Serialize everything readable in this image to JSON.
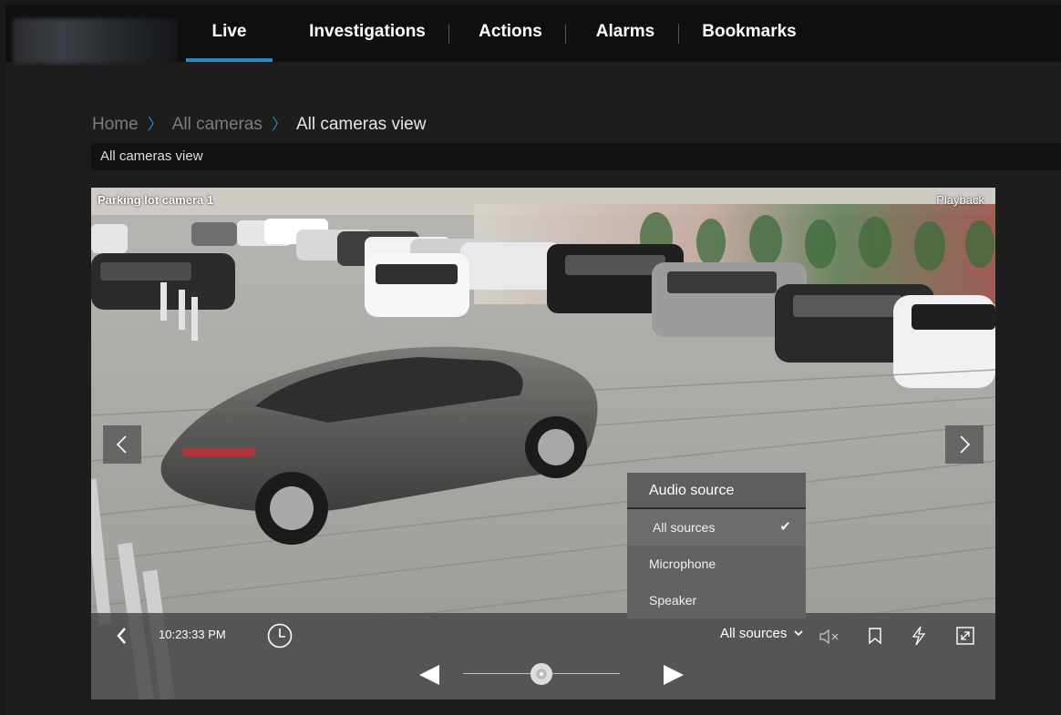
{
  "nav": {
    "tabs": [
      {
        "label": "Live",
        "active": true
      },
      {
        "label": "Investigations"
      },
      {
        "label": "Actions"
      },
      {
        "label": "Alarms"
      },
      {
        "label": "Bookmarks"
      }
    ]
  },
  "breadcrumb": {
    "items": [
      "Home",
      "All cameras",
      "All cameras view"
    ],
    "separator": "〉"
  },
  "view_name": "All cameras view",
  "camera": {
    "title": "Parking lot camera 1",
    "playback_label": "Playback",
    "prev_icon": "chevron-left-icon",
    "next_icon": "chevron-right-icon"
  },
  "audio_menu": {
    "header": "Audio source",
    "items": [
      "All sources",
      "Microphone",
      "Speaker"
    ],
    "selected": "All sources"
  },
  "controls": {
    "time": "10:23:33 PM",
    "audio_source_label": "All sources",
    "timeline_position": 0.5,
    "accent": "#2a88c6"
  }
}
